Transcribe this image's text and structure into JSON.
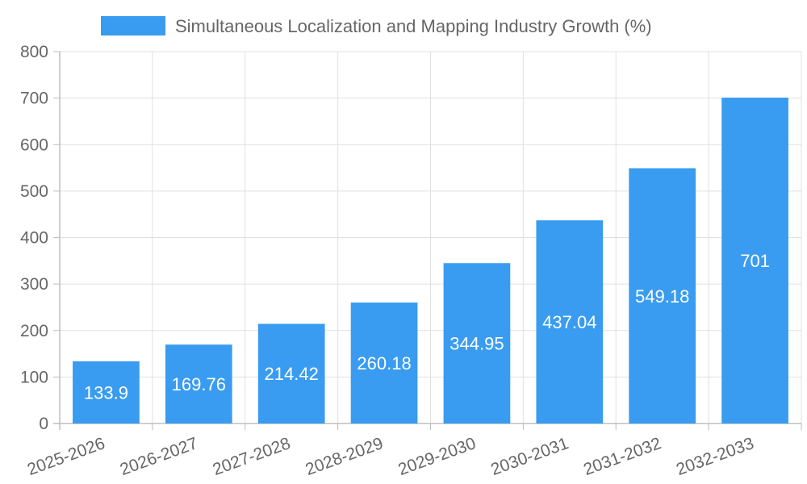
{
  "chart_data": {
    "type": "bar",
    "categories": [
      "2025-2026",
      "2026-2027",
      "2027-2028",
      "2028-2029",
      "2029-2030",
      "2030-2031",
      "2031-2032",
      "2032-2033"
    ],
    "series": [
      {
        "name": "Simultaneous Localization and Mapping Industry Growth (%)",
        "values": [
          133.9,
          169.76,
          214.42,
          260.18,
          344.95,
          437.04,
          549.18,
          701
        ]
      }
    ],
    "data_labels": [
      "133.9",
      "169.76",
      "214.42",
      "260.18",
      "344.95",
      "437.04",
      "549.18",
      "701"
    ],
    "ylim": [
      0,
      800
    ],
    "yticks": [
      0,
      100,
      200,
      300,
      400,
      500,
      600,
      700,
      800
    ],
    "grid": true,
    "legend_position": "top-center",
    "colors": {
      "bar": "#399cf0",
      "grid": "#e0e0e0",
      "axis": "#bdbdbd",
      "text": "#666666",
      "label": "#ffffff"
    }
  }
}
